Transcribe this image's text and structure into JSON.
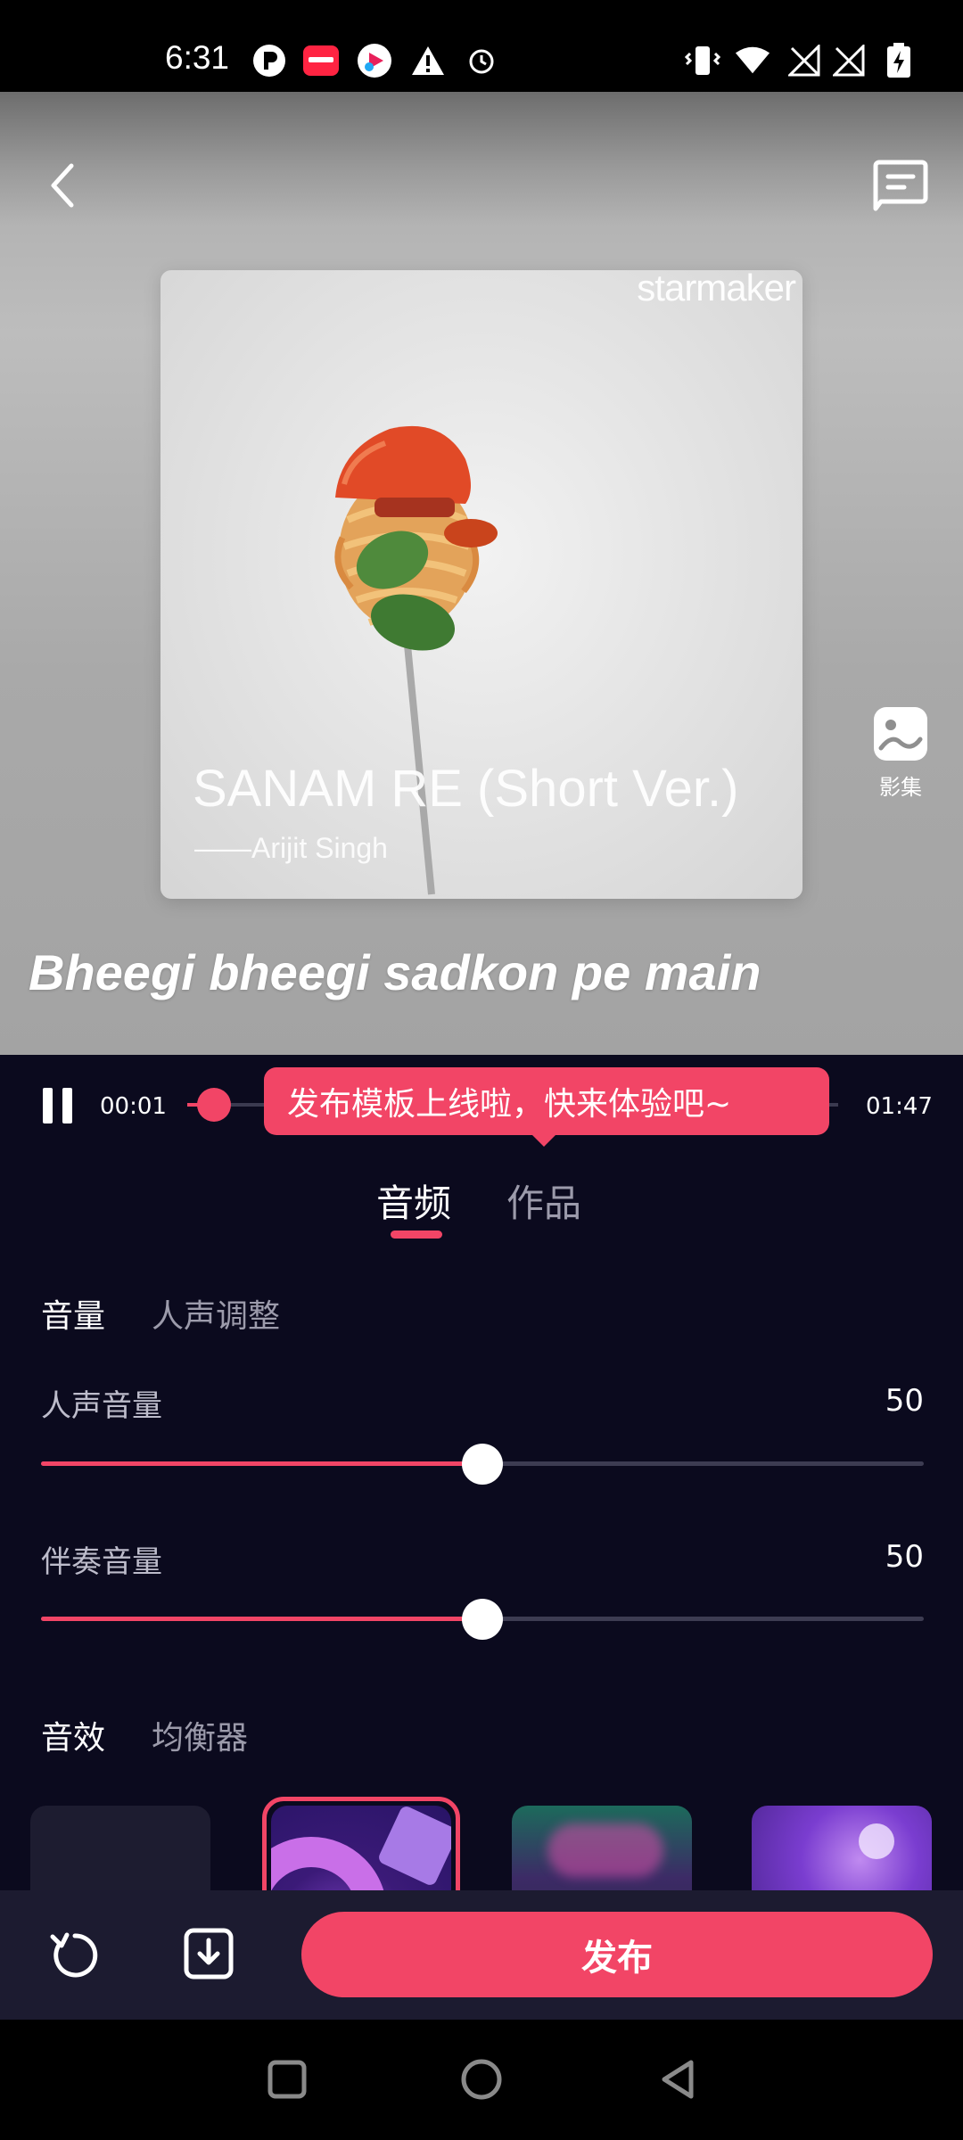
{
  "status_bar": {
    "time": "6:31",
    "left_icons": [
      "p-app-icon",
      "xiaohongshu-icon",
      "video-app-icon",
      "warning-icon",
      "alarm-icon"
    ],
    "right_icons": [
      "vibrate-icon",
      "wifi-icon",
      "no-signal-icon",
      "no-signal-icon",
      "battery-charging-icon"
    ]
  },
  "hero": {
    "brand": "starmaker",
    "song_title": "SANAM RE (Short Ver.)",
    "song_artist": "——Arijit Singh",
    "album_label": "影集",
    "lyric": "Bheegi bheegi sadkon pe main"
  },
  "player": {
    "current_time": "00:01",
    "total_time": "01:47",
    "progress_fraction": 0.01,
    "tooltip": "发布模板上线啦，快来体验吧~"
  },
  "tabs": {
    "audio": "音频",
    "works": "作品"
  },
  "volume_section": {
    "tab_volume": "音量",
    "tab_vocal_adjust": "人声调整"
  },
  "sliders": [
    {
      "label": "人声音量",
      "value": "50"
    },
    {
      "label": "伴奏音量",
      "value": "50"
    }
  ],
  "effects_section": {
    "tab_effects": "音效",
    "tab_equalizer": "均衡器"
  },
  "bottom_bar": {
    "publish_label": "发布"
  },
  "colors": {
    "accent": "#f24566",
    "background": "#0b0a1e",
    "bottom_bar": "#1c1b30"
  }
}
